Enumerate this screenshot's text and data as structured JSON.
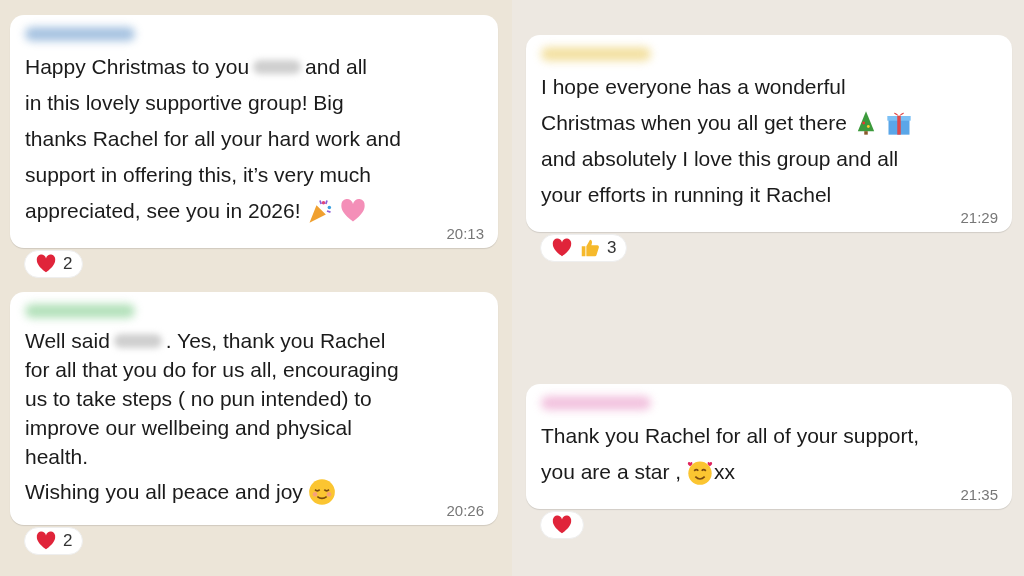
{
  "columns": [
    {
      "messages": [
        {
          "paragraphs": [
            [
              [
                {
                  "kind": "text",
                  "text": "Happy Christmas to you"
                },
                {
                  "kind": "redacted"
                },
                {
                  "kind": "text",
                  "text": "and all"
                }
              ],
              [
                {
                  "kind": "text",
                  "text": "in this lovely supportive group! Big"
                }
              ],
              [
                {
                  "kind": "text",
                  "text": "thanks Rachel for all your hard work and"
                }
              ],
              [
                {
                  "kind": "text",
                  "text": "support in offering this, it’s very much"
                }
              ],
              [
                {
                  "kind": "text",
                  "text": "appreciated, see you in 2026!"
                },
                {
                  "kind": "party"
                },
                {
                  "kind": "heart"
                }
              ]
            ]
          ],
          "time": "20:13",
          "reactions": [
            {
              "kind": "heart"
            }
          ],
          "reaction_count": "2"
        },
        {
          "paragraphs": [
            [
              [
                {
                  "kind": "text",
                  "text": "Well said"
                },
                {
                  "kind": "redacted"
                },
                {
                  "kind": "text",
                  "text": ". Yes, thank you Rachel"
                }
              ],
              [
                {
                  "kind": "text",
                  "text": "for all that you do for us all, encouraging"
                }
              ],
              [
                {
                  "kind": "text",
                  "text": "us to take steps ( no pun intended) to"
                }
              ],
              [
                {
                  "kind": "text",
                  "text": "improve our wellbeing and physical"
                }
              ],
              [
                {
                  "kind": "text",
                  "text": "health."
                }
              ]
            ],
            [
              [
                {
                  "kind": "text",
                  "text": "Wishing you all peace and joy"
                },
                {
                  "kind": "relieved"
                }
              ]
            ]
          ],
          "time": "20:26",
          "reactions": [
            {
              "kind": "heart"
            }
          ],
          "reaction_count": "2"
        }
      ]
    },
    {
      "messages": [
        {
          "paragraphs": [
            [
              [
                {
                  "kind": "text",
                  "text": "I hope everyone has a wonderful"
                }
              ],
              [
                {
                  "kind": "text",
                  "text": "Christmas when you all get there"
                },
                {
                  "kind": "tree"
                },
                {
                  "kind": "gift"
                }
              ],
              [
                {
                  "kind": "text",
                  "text": "and absolutely I love this group and all"
                }
              ],
              [
                {
                  "kind": "text",
                  "text": "your efforts in running it Rachel"
                }
              ]
            ]
          ],
          "time": "21:29",
          "reactions": [
            {
              "kind": "heart"
            },
            {
              "kind": "thumbs"
            }
          ],
          "reaction_count": "3"
        },
        {
          "paragraphs": [
            [
              [
                {
                  "kind": "text",
                  "text": "Thank you Rachel for all of your support,"
                }
              ],
              [
                {
                  "kind": "text",
                  "text": "you are a star ,"
                },
                {
                  "kind": "smiling-hearts"
                },
                {
                  "kind": "text",
                  "text": "xx"
                }
              ]
            ]
          ],
          "time": "21:35",
          "reactions": [
            {
              "kind": "heart"
            }
          ]
        }
      ]
    }
  ]
}
